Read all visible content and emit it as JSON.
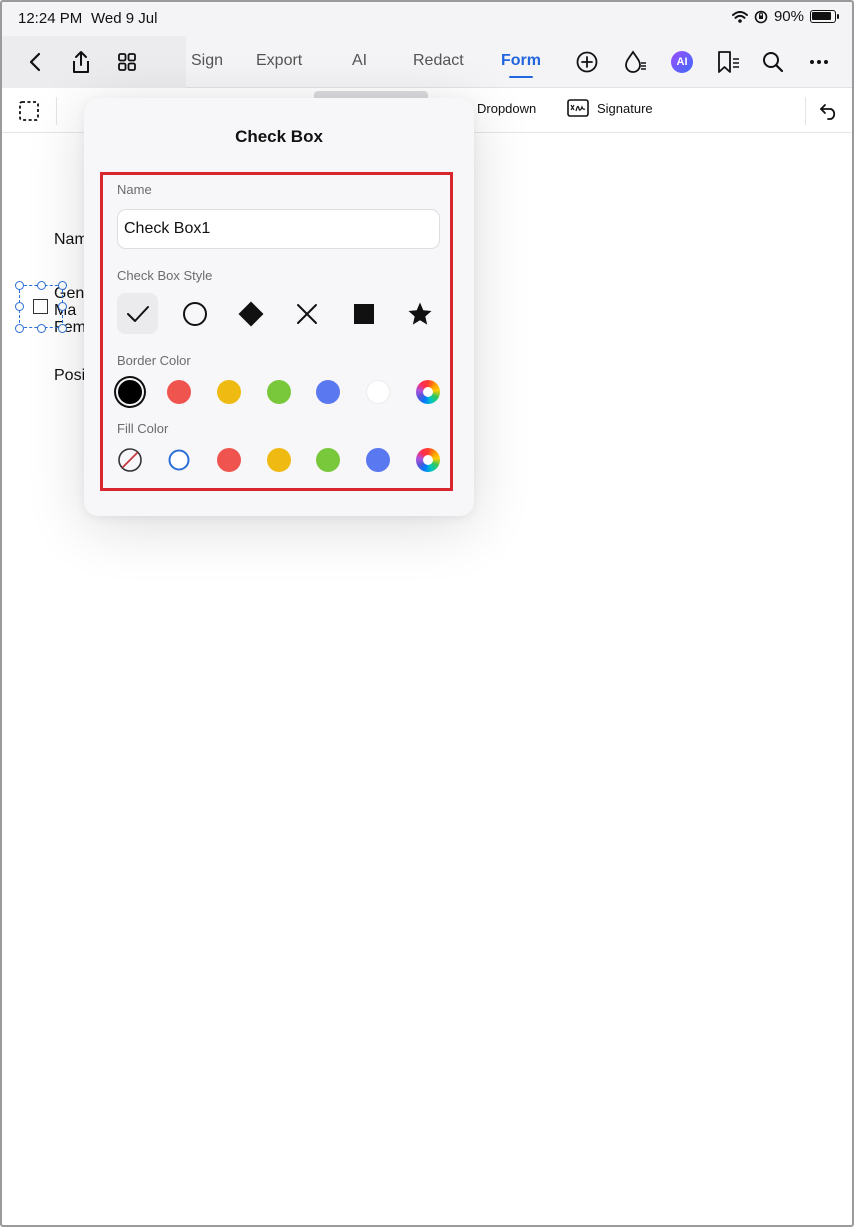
{
  "status_bar": {
    "time": "12:24 PM",
    "date": "Wed 9 Jul",
    "battery": "90%"
  },
  "nav": {
    "tabs": [
      {
        "label": "Sign"
      },
      {
        "label": "Export"
      },
      {
        "label": "AI"
      },
      {
        "label": "Redact"
      },
      {
        "label": "Form"
      }
    ],
    "active_tab": "Form",
    "ai_badge": "AI"
  },
  "toolstrip": {
    "dropdown_label": "Dropdown",
    "signature_label": "Signature"
  },
  "document": {
    "lines": [
      "Nam",
      "Gen",
      "Ma",
      "Fem",
      "Posi"
    ]
  },
  "popover": {
    "title": "Check Box",
    "name_label": "Name",
    "name_value": "Check Box1",
    "style_label": "Check Box Style",
    "styles": [
      "check-icon",
      "circle-icon",
      "diamond-icon",
      "cross-icon",
      "square-icon",
      "star-icon"
    ],
    "selected_style": "check-icon",
    "border_color_label": "Border Color",
    "border_colors": [
      "#000000",
      "#f0544f",
      "#efbb12",
      "#79c83b",
      "#5a78f0",
      "#ffffff",
      "custom"
    ],
    "selected_border_color": "#000000",
    "fill_color_label": "Fill Color",
    "fill_colors": [
      "none",
      "transparent-blue",
      "#f0544f",
      "#efbb12",
      "#79c83b",
      "#5a78f0",
      "custom"
    ]
  },
  "colors": {
    "accent": "#2266dd",
    "highlight": "#d8262e"
  }
}
